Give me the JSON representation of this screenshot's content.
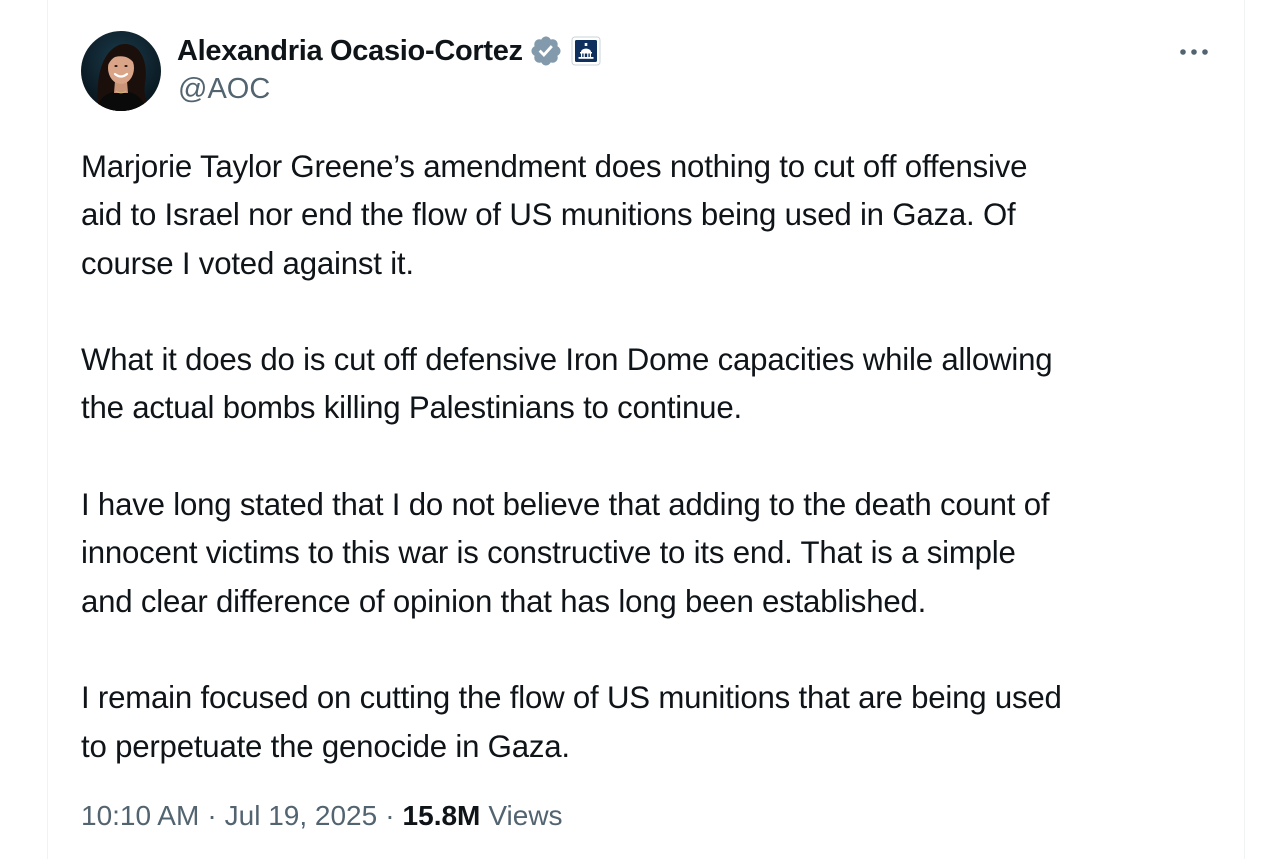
{
  "author": {
    "display_name": "Alexandria Ocasio-Cortez",
    "handle": "@AOC",
    "verified_icon": "verified-badge-icon",
    "affiliation_icon": "us-capitol-badge-icon",
    "avatar_icon": "profile-photo"
  },
  "menu": {
    "icon": "more-options-icon"
  },
  "tweet": {
    "paragraphs": [
      "Marjorie Taylor Greene’s amendment does nothing to cut off offensive\naid to Israel nor end the flow of US munitions being used in Gaza. Of\ncourse I voted against it.",
      "What it does do is cut off defensive Iron Dome capacities while allowing\nthe actual bombs killing Palestinians to continue.",
      "I have long stated that I do not believe that adding to the death count of\ninnocent victims to this war is constructive to its end. That is a simple\nand clear difference of opinion that has long been established.",
      "I remain focused on cutting the flow of US munitions that are being used\nto perpetuate the genocide in Gaza."
    ]
  },
  "meta": {
    "time": "10:10 AM",
    "separator": "·",
    "date": "Jul 19, 2025",
    "views_count": "15.8M",
    "views_label": "Views"
  },
  "colors": {
    "text_primary": "#0f1419",
    "text_secondary": "#536471",
    "verified_badge": "#829aab",
    "gov_badge_bg": "#0f2f5c",
    "border": "#eff3f4"
  }
}
